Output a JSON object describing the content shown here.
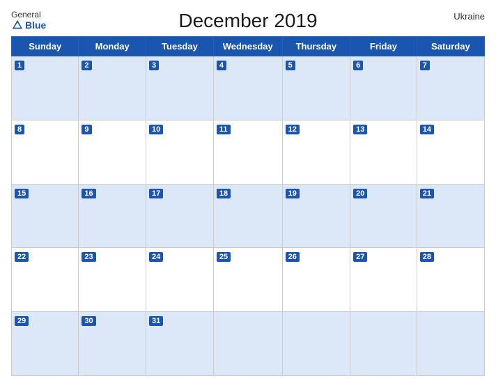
{
  "header": {
    "logo_general": "General",
    "logo_blue": "Blue",
    "month_title": "December 2019",
    "country": "Ukraine"
  },
  "weekdays": [
    "Sunday",
    "Monday",
    "Tuesday",
    "Wednesday",
    "Thursday",
    "Friday",
    "Saturday"
  ],
  "weeks": [
    [
      {
        "day": 1,
        "empty": false
      },
      {
        "day": 2,
        "empty": false
      },
      {
        "day": 3,
        "empty": false
      },
      {
        "day": 4,
        "empty": false
      },
      {
        "day": 5,
        "empty": false
      },
      {
        "day": 6,
        "empty": false
      },
      {
        "day": 7,
        "empty": false
      }
    ],
    [
      {
        "day": 8,
        "empty": false
      },
      {
        "day": 9,
        "empty": false
      },
      {
        "day": 10,
        "empty": false
      },
      {
        "day": 11,
        "empty": false
      },
      {
        "day": 12,
        "empty": false
      },
      {
        "day": 13,
        "empty": false
      },
      {
        "day": 14,
        "empty": false
      }
    ],
    [
      {
        "day": 15,
        "empty": false
      },
      {
        "day": 16,
        "empty": false
      },
      {
        "day": 17,
        "empty": false
      },
      {
        "day": 18,
        "empty": false
      },
      {
        "day": 19,
        "empty": false
      },
      {
        "day": 20,
        "empty": false
      },
      {
        "day": 21,
        "empty": false
      }
    ],
    [
      {
        "day": 22,
        "empty": false
      },
      {
        "day": 23,
        "empty": false
      },
      {
        "day": 24,
        "empty": false
      },
      {
        "day": 25,
        "empty": false
      },
      {
        "day": 26,
        "empty": false
      },
      {
        "day": 27,
        "empty": false
      },
      {
        "day": 28,
        "empty": false
      }
    ],
    [
      {
        "day": 29,
        "empty": false
      },
      {
        "day": 30,
        "empty": false
      },
      {
        "day": 31,
        "empty": false
      },
      {
        "day": null,
        "empty": true
      },
      {
        "day": null,
        "empty": true
      },
      {
        "day": null,
        "empty": true
      },
      {
        "day": null,
        "empty": true
      }
    ]
  ]
}
